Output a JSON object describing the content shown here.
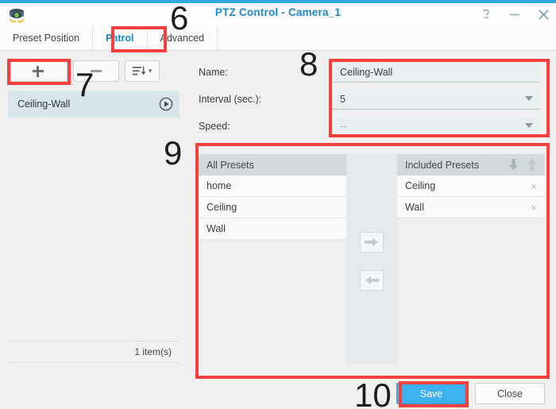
{
  "window": {
    "title": "PTZ Control - Camera_1",
    "app_icon": "dome-camera-icon",
    "help_label": "?",
    "minimize_label": "–",
    "close_label": "✕",
    "accent_color": "#36a8e0",
    "title_color": "#1b87c9",
    "annotation_color": "#f5413e"
  },
  "tabs": [
    {
      "label": "Preset Position",
      "active": false
    },
    {
      "label": "Patrol",
      "active": true
    },
    {
      "label": "Advanced",
      "active": false
    }
  ],
  "left_panel": {
    "toolbar": {
      "add_label": "+",
      "remove_label": "–",
      "sort_label": "sort-descending",
      "sort_caret": "▾"
    },
    "items": [
      {
        "name": "Ceiling-Wall",
        "action_icon": "play-icon",
        "selected": true
      }
    ],
    "footer_count": "1 item(s)"
  },
  "form": {
    "rows": [
      {
        "label": "Name:",
        "value": "Ceiling-Wall",
        "type": "text",
        "muted": false
      },
      {
        "label": "Interval (sec.):",
        "value": "5",
        "type": "select",
        "muted": false
      },
      {
        "label": "Speed:",
        "value": "--",
        "type": "select",
        "muted": true
      }
    ]
  },
  "dual_list": {
    "all_presets": {
      "header": "All Presets",
      "items": [
        "home",
        "Ceiling",
        "Wall"
      ]
    },
    "included_presets": {
      "header": "Included Presets",
      "move_down_icon": "arrow-down-icon",
      "move_up_icon": "arrow-up-icon",
      "items": [
        {
          "name": "Ceiling",
          "remove_icon": "×"
        },
        {
          "name": "Wall",
          "remove_icon": "×"
        }
      ]
    },
    "add_button_icon": "arrow-right-icon",
    "remove_button_icon": "arrow-left-icon"
  },
  "footer": {
    "save_label": "Save",
    "close_label": "Close"
  },
  "annotations": {
    "numbers": [
      "6",
      "7",
      "8",
      "9",
      "10"
    ]
  }
}
